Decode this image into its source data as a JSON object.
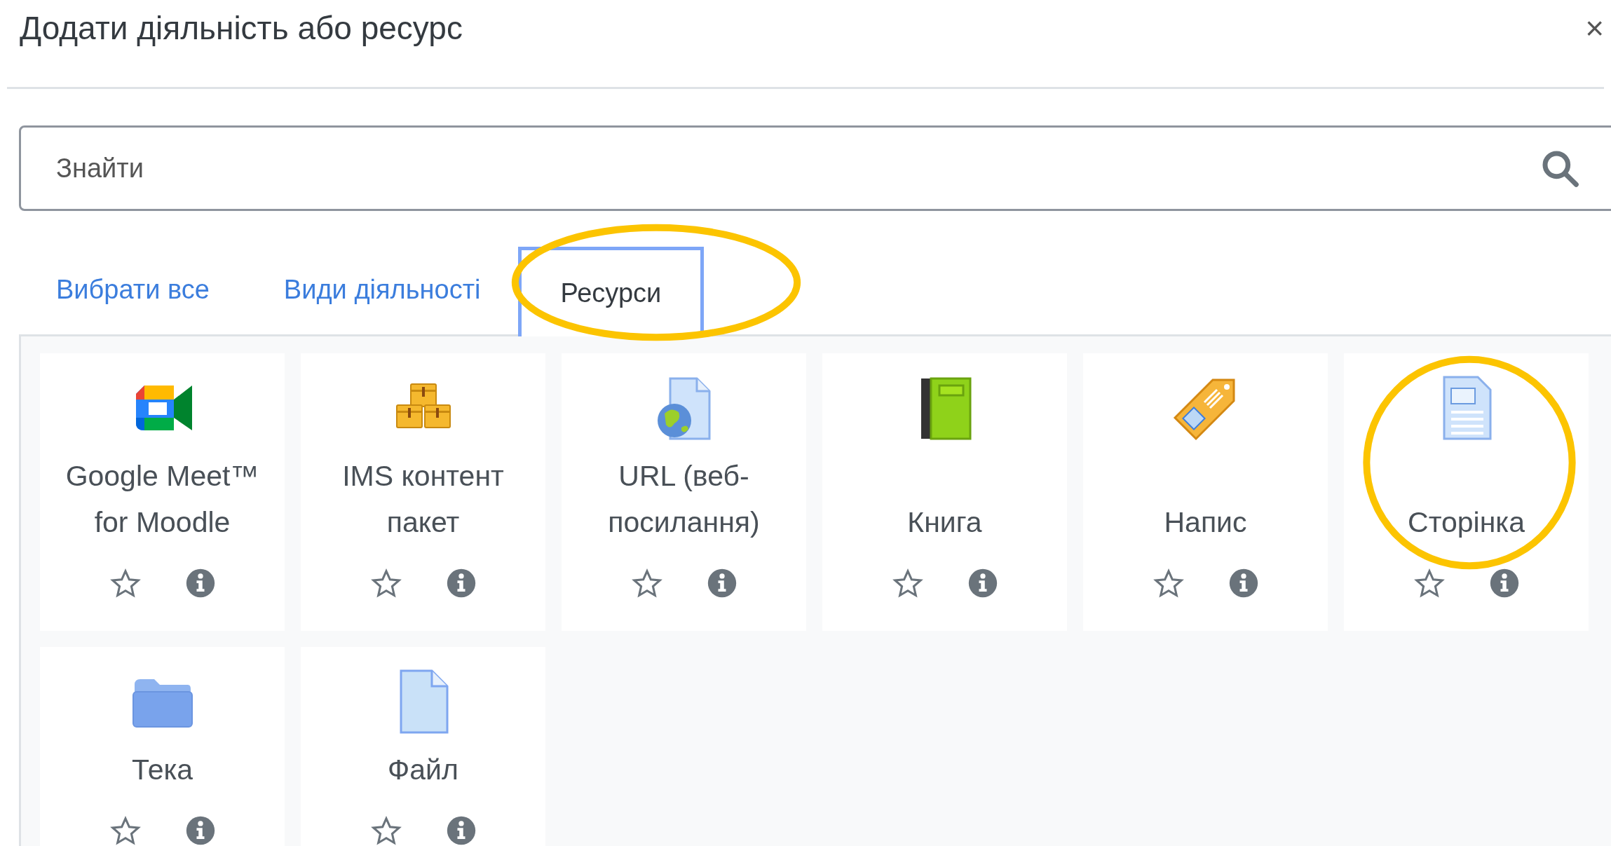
{
  "dialog": {
    "title": "Додати діяльність або ресурс",
    "close": "×"
  },
  "search": {
    "placeholder": "Знайти"
  },
  "tabs": [
    {
      "label": "Вибрати все",
      "selected": false
    },
    {
      "label": "Види діяльності",
      "selected": false
    },
    {
      "label": "Ресурси",
      "selected": true
    }
  ],
  "items": [
    {
      "label": "Google Meet™ for Moodle",
      "kind": "meet",
      "starred": false
    },
    {
      "label": "IMS контент пакет",
      "kind": "package",
      "starred": false
    },
    {
      "label": "URL (веб-посилання)",
      "kind": "url",
      "starred": false
    },
    {
      "label": "Книга",
      "kind": "book",
      "starred": false
    },
    {
      "label": "Напис",
      "kind": "label",
      "starred": false
    },
    {
      "label": "Сторінка",
      "kind": "page",
      "starred": false
    },
    {
      "label": "Тека",
      "kind": "folder",
      "starred": false
    },
    {
      "label": "Файл",
      "kind": "file",
      "starred": false
    }
  ],
  "annotations": [
    {
      "kind": "ellipse"
    },
    {
      "kind": "ellipse"
    }
  ]
}
